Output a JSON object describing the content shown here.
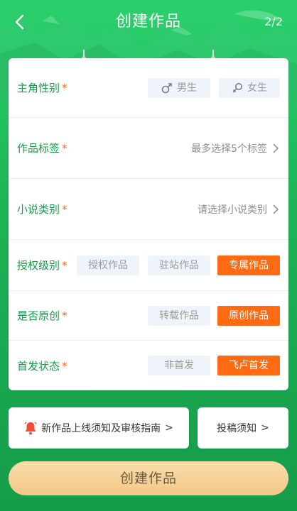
{
  "header": {
    "title": "创建作品",
    "step": "2/2"
  },
  "form": {
    "gender": {
      "label": "主角性别",
      "required_mark": "*",
      "options": [
        "男生",
        "女生"
      ]
    },
    "tags": {
      "label": "作品标签",
      "required_mark": "*",
      "placeholder": "最多选择5个标签"
    },
    "category": {
      "label": "小说类别",
      "required_mark": "*",
      "placeholder": "请选择小说类别"
    },
    "license": {
      "label": "授权级别",
      "required_mark": "*",
      "options": [
        "授权作品",
        "驻站作品",
        "专属作品"
      ],
      "selected": "专属作品"
    },
    "original": {
      "label": "是否原创",
      "required_mark": "*",
      "options": [
        "转载作品",
        "原创作品"
      ],
      "selected": "原创作品"
    },
    "first_release": {
      "label": "首发状态",
      "required_mark": "*",
      "options": [
        "非首发",
        "飞卢首发"
      ],
      "selected": "飞卢首发"
    }
  },
  "links": {
    "guide": "新作品上线须知及审核指南",
    "guide_arrow": ">",
    "submit_notice": "投稿须知",
    "submit_arrow": ">"
  },
  "create_button": "创建作品",
  "colors": {
    "accent_green": "#159c49",
    "selected_orange": "#ff6a12",
    "button_gold": "#f4c888"
  },
  "icons": [
    "back-arrow-icon",
    "male-icon",
    "female-icon",
    "chevron-right-icon",
    "bell-icon"
  ]
}
